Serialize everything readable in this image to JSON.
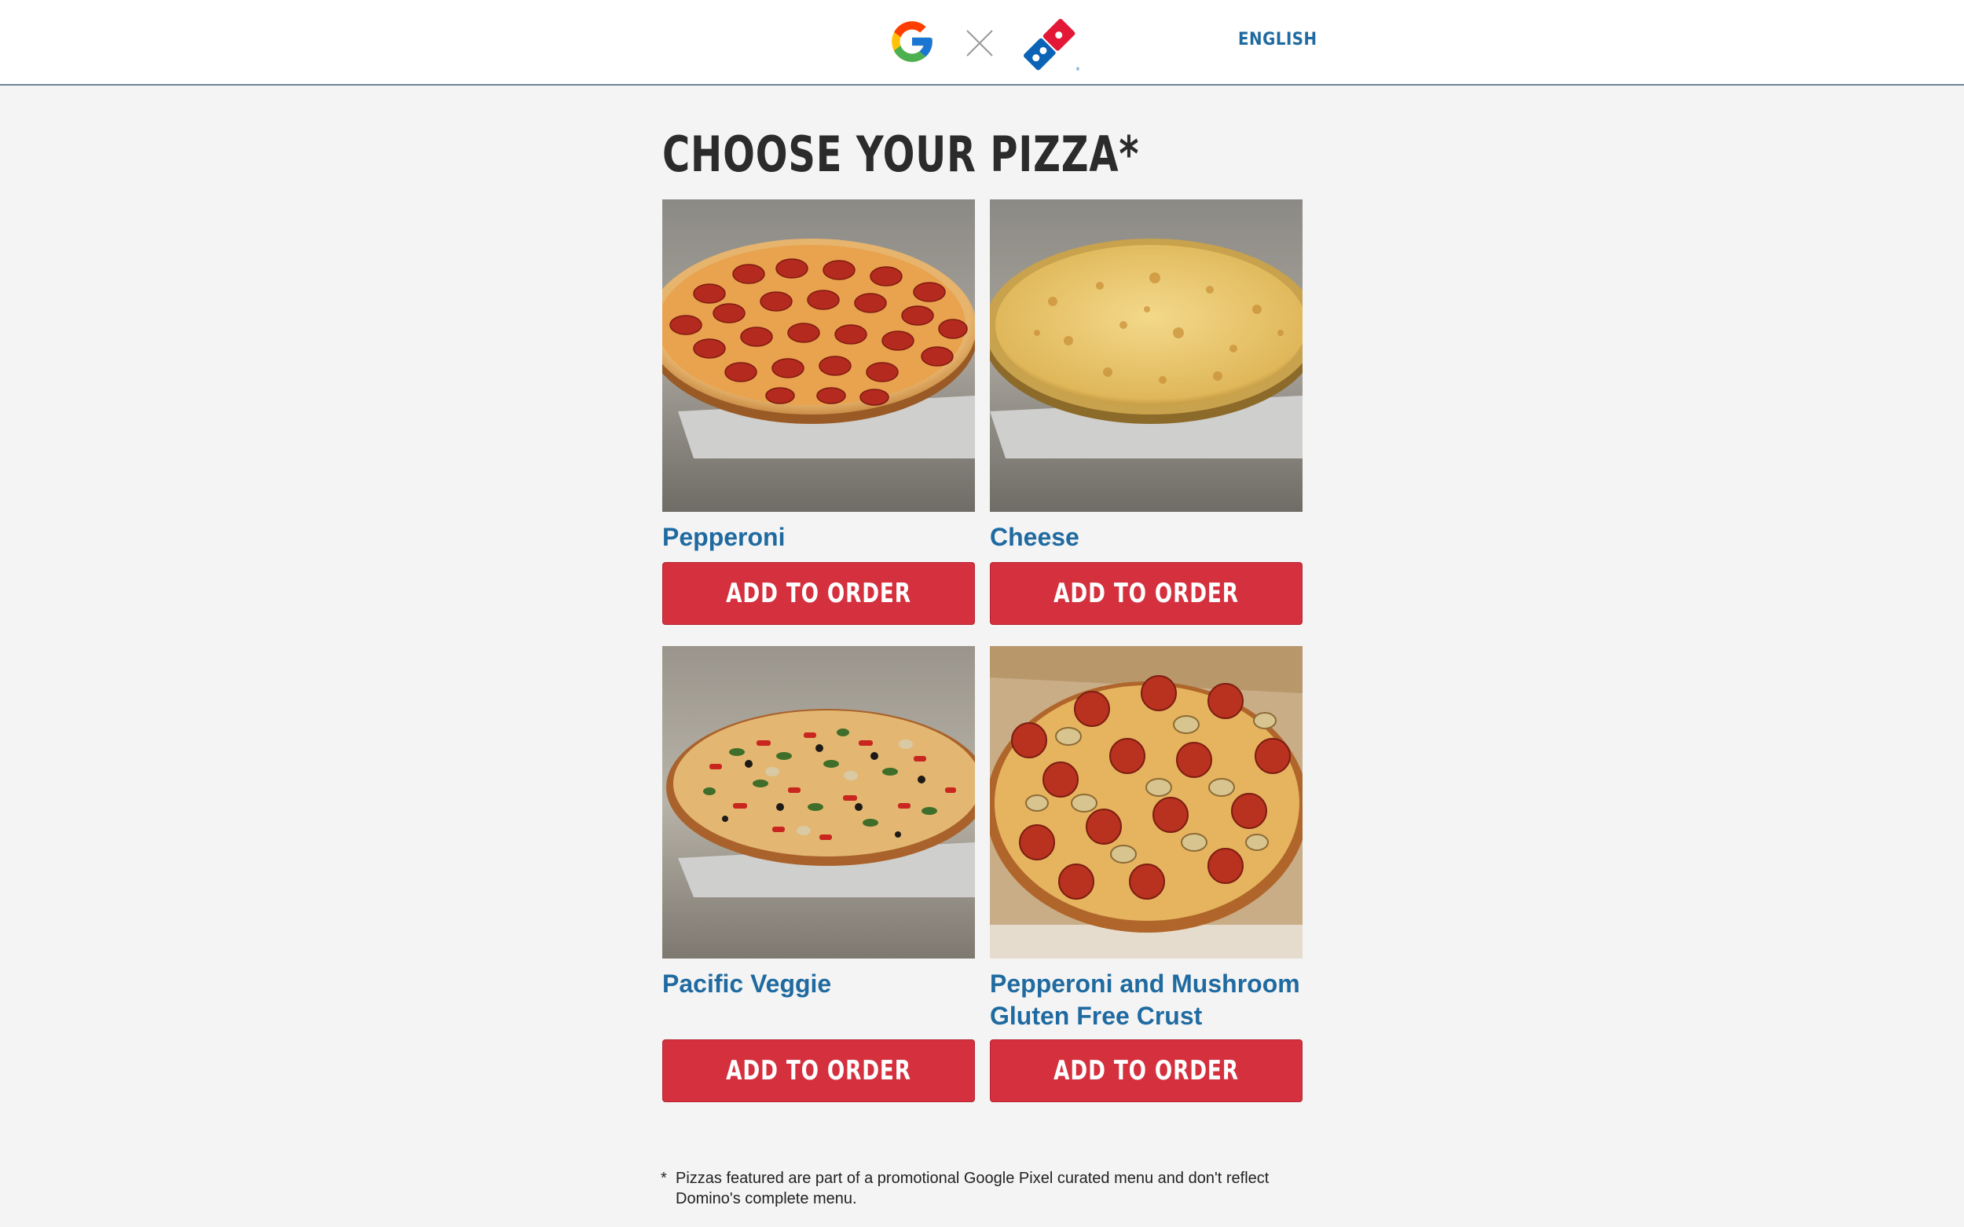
{
  "header": {
    "partner_logo_icon": "google-g-icon",
    "separator_icon": "times-icon",
    "brand_logo_icon": "dominos-logo-icon",
    "language_label": "ENGLISH"
  },
  "main": {
    "title": "CHOOSE YOUR PIZZA*",
    "pizzas": [
      {
        "name": "Pepperoni",
        "button_label": "ADD TO ORDER",
        "image_icon": "pepperoni-pizza-photo"
      },
      {
        "name": "Cheese",
        "button_label": "ADD TO ORDER",
        "image_icon": "cheese-pizza-photo"
      },
      {
        "name": "Pacific Veggie",
        "button_label": "ADD TO ORDER",
        "image_icon": "pacific-veggie-pizza-photo"
      },
      {
        "name": "Pepperoni and Mushroom Gluten Free Crust",
        "button_label": "ADD TO ORDER",
        "image_icon": "pepperoni-mushroom-pizza-photo"
      }
    ]
  },
  "footnote": {
    "marker": "*",
    "text": "Pizzas featured are part of a promotional Google Pixel curated menu and don't reflect Domino's complete menu."
  },
  "colors": {
    "accent_red": "#d5303e",
    "link_blue": "#1f6aa0",
    "page_bg": "#f4f4f4",
    "dominos_blue": "#0b63b6",
    "dominos_red": "#e31837"
  }
}
